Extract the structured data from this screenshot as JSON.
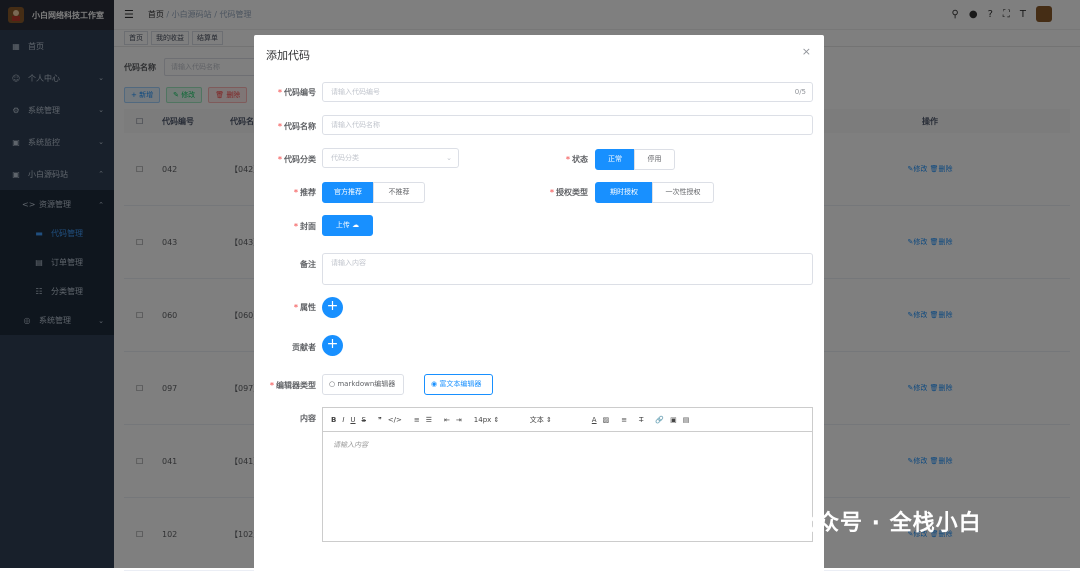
{
  "app": {
    "title": "小白网络科技工作室"
  },
  "sidebar": {
    "items": [
      {
        "label": "首页",
        "icon": "dashboard-icon"
      },
      {
        "label": "个人中心",
        "icon": "user-icon"
      },
      {
        "label": "系统管理",
        "icon": "system-icon"
      },
      {
        "label": "系统监控",
        "icon": "monitor-icon"
      },
      {
        "label": "小白源码站",
        "icon": "source-icon"
      }
    ],
    "sub_group": {
      "label": "资源管理"
    },
    "sub_items": [
      {
        "label": "代码管理"
      },
      {
        "label": "订单管理"
      },
      {
        "label": "分类管理"
      }
    ],
    "bottom_item": {
      "label": "系统管理"
    }
  },
  "navbar": {
    "breadcrumb_home": "首页",
    "breadcrumb_sep": "/",
    "breadcrumb_mid": "小白源码站",
    "breadcrumb_current": "代码管理"
  },
  "tags": [
    "首页",
    "我的收益",
    "结算单"
  ],
  "search": {
    "label": "代码名称",
    "placeholder": "请输入代码名称"
  },
  "toolbar": {
    "add": "新增",
    "edit": "修改",
    "delete": "删除"
  },
  "table": {
    "headers": {
      "code": "代码编号",
      "name": "代码名",
      "ops": "操作"
    },
    "rows": [
      {
        "code": "042",
        "name": "【042】"
      },
      {
        "code": "043",
        "name": "【043】"
      },
      {
        "code": "060",
        "name": "【060】"
      },
      {
        "code": "097",
        "name": "【097】"
      },
      {
        "code": "041",
        "name": "【041】"
      },
      {
        "code": "102",
        "name": "【102】"
      }
    ],
    "op_edit": "修改",
    "op_delete": "删除"
  },
  "dialog": {
    "title": "添加代码",
    "close": "×",
    "code_no": {
      "label": "代码编号",
      "placeholder": "请输入代码编号",
      "counter": "0/5"
    },
    "code_name": {
      "label": "代码名称",
      "placeholder": "请输入代码名称"
    },
    "category": {
      "label": "代码分类",
      "placeholder": "代码分类"
    },
    "status": {
      "label": "状态",
      "options": [
        "正常",
        "停用"
      ],
      "selected": "正常"
    },
    "recommend": {
      "label": "推荐",
      "options": [
        "官方推荐",
        "不推荐"
      ],
      "selected": "官方推荐"
    },
    "license": {
      "label": "授权类型",
      "options": [
        "期时授权",
        "一次性授权"
      ],
      "selected": "期时授权"
    },
    "cover": {
      "label": "封面",
      "button": "上传"
    },
    "remark": {
      "label": "备注",
      "placeholder": "请输入内容"
    },
    "attribute": {
      "label": "属性"
    },
    "contributor": {
      "label": "贡献者"
    },
    "editor_type": {
      "label": "编辑器类型",
      "options": [
        "markdown编辑器",
        "富文本编辑器"
      ],
      "selected": "富文本编辑器"
    },
    "content": {
      "label": "内容",
      "placeholder": "请输入内容",
      "font_size": "14px",
      "paragraph": "文本"
    }
  },
  "watermark": {
    "text": "公众号 · 全栈小白"
  },
  "colors": {
    "primary": "#1890ff",
    "sidebar": "#304156",
    "danger": "#f56c6c"
  }
}
